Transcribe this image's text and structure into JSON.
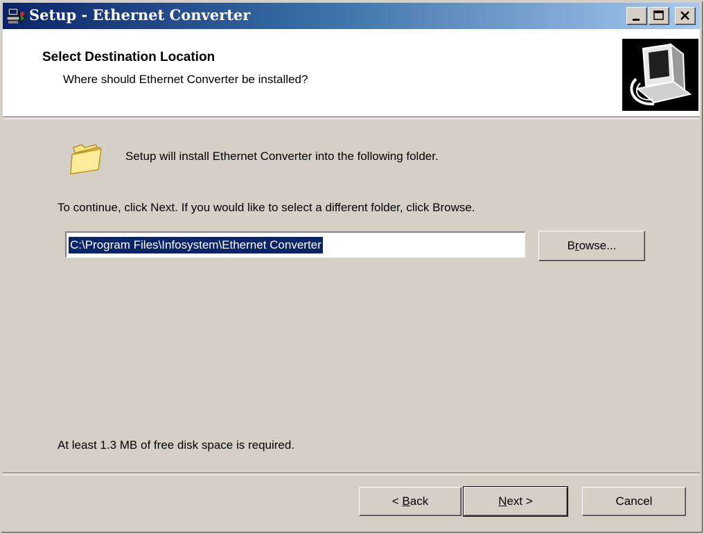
{
  "window": {
    "title": "Setup - Ethernet Converter",
    "app_icon": "setup-computer-icon",
    "controls": {
      "minimize": "minimize-icon",
      "maximize": "maximize-icon",
      "close": "close-icon"
    }
  },
  "header": {
    "title": "Select Destination Location",
    "subtitle": "Where should Ethernet Converter be installed?",
    "image_icon": "installer-computer-icon"
  },
  "body": {
    "intro": "Setup will install Ethernet Converter into the following folder.",
    "folder_icon": "folder-icon",
    "instruction": "To continue, click Next. If you would like to select a different folder, click Browse.",
    "path_value": "C:\\Program Files\\Infosystem\\Ethernet Converter",
    "browse_label": {
      "pre": "B",
      "accel": "r",
      "post": "owse..."
    },
    "disk_space": "At least 1.3 MB of free disk space is required."
  },
  "buttons": {
    "back": {
      "pre": "< ",
      "accel": "B",
      "post": "ack"
    },
    "next": {
      "pre": "",
      "accel": "N",
      "post": "ext >"
    },
    "cancel": "Cancel"
  },
  "colors": {
    "titlebar_start": "#0a246a",
    "titlebar_end": "#a6caf0",
    "dialog_bg": "#d4d0c8",
    "selection_bg": "#0a246a"
  }
}
